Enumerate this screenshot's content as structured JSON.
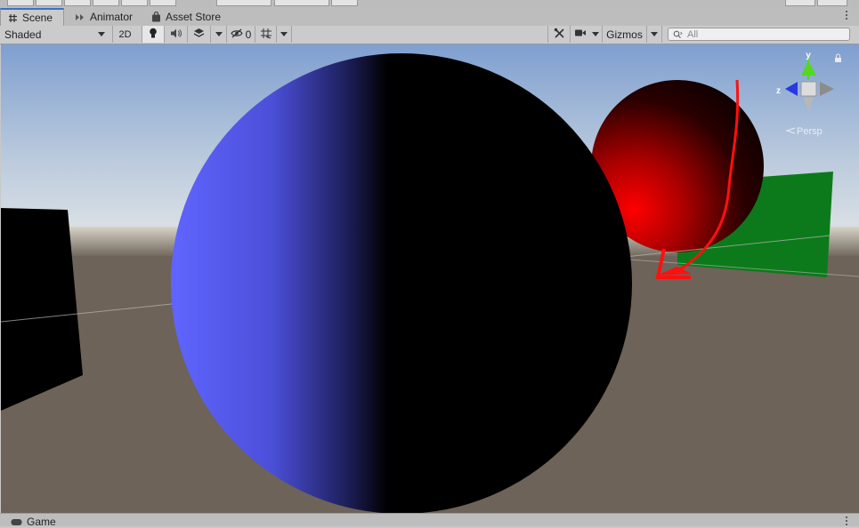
{
  "tabs": [
    {
      "label": "Scene",
      "icon": "hash-icon",
      "active": true
    },
    {
      "label": "Animator",
      "icon": "animator-icon",
      "active": false
    },
    {
      "label": "Asset Store",
      "icon": "bag-icon",
      "active": false
    }
  ],
  "toolbar": {
    "draw_mode": "Shaded",
    "toggle_2d": "2D",
    "hidden_count": "0",
    "gizmos_label": "Gizmos",
    "search_placeholder": "All",
    "search_value": ""
  },
  "scene": {
    "gizmo_axes": {
      "y": "y",
      "z": "z"
    },
    "projection_label": "Persp",
    "colors": {
      "sky_top": "#7f9fd0",
      "sky_horizon": "#dfe3e6",
      "ground": "#6d6358",
      "blue_sphere": "#5b5ff5",
      "red_sphere": "#e00000",
      "green_plane": "#0c7a1a"
    }
  },
  "bottom_tab": {
    "label": "Game",
    "icon": "gamepad-icon"
  }
}
